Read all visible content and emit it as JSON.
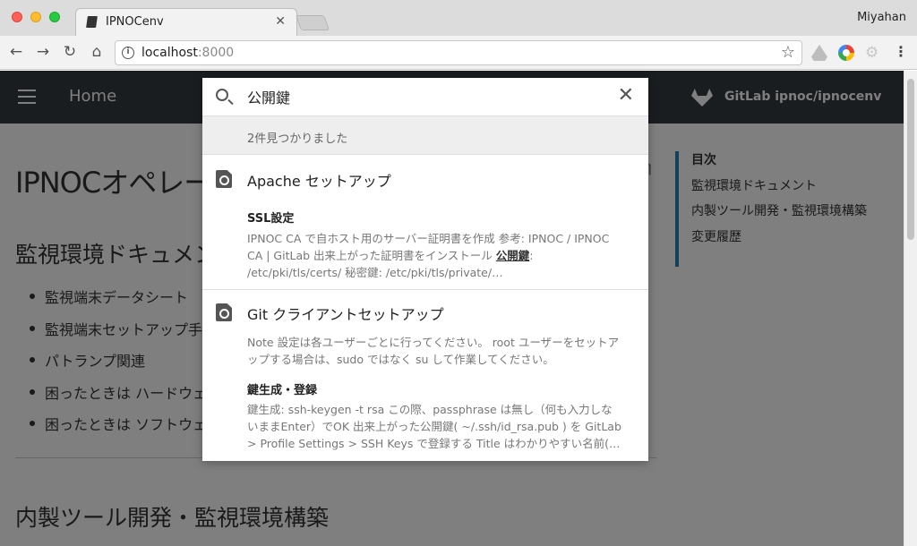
{
  "browser": {
    "tab_title": "IPNOCenv",
    "profile_name": "Miyahan",
    "url_host": "localhost",
    "url_port": ":8000"
  },
  "header": {
    "home_label": "Home",
    "gitlab_label": "GitLab ipnoc/ipnocenv"
  },
  "content": {
    "page_title": "IPNOCオペレーション",
    "section1_title": "監視環境ドキュメント",
    "bullets": [
      "監視端末データシート",
      "監視端末セットアップ手順",
      "パトランプ関連",
      "困ったときは ハードウェア",
      "困ったときは ソフトウェア"
    ],
    "section2_title": "内製ツール開発・監視環境構築"
  },
  "toc": {
    "heading": "目次",
    "items": [
      "監視環境ドキュメント",
      "内製ツール開発・監視環境構築",
      "変更履歴"
    ]
  },
  "search": {
    "query": "公開鍵",
    "result_count": "2件見つかりました",
    "results": [
      {
        "title": "Apache セットアップ",
        "sections": [
          {
            "heading": "SSL設定",
            "snippet_before": "IPNOC CA で自ホスト用のサーバー証明書を作成 参考: IPNOC / IPNOC CA | GitLab 出来上がった証明書をインストール ",
            "snippet_match": "公開鍵",
            "snippet_after": ": /etc/pki/tls/certs/ 秘密鍵: /etc/pki/tls/private/…"
          }
        ]
      },
      {
        "title": "Git クライアントセットアップ",
        "intro": "Note 設定は各ユーザーごとに行ってください。 root ユーザーをセットアップする場合は、sudo ではなく su して作業してください。",
        "sections": [
          {
            "heading": "鍵生成・登録",
            "snippet": "鍵生成: ssh-keygen -t rsa この際、passphrase は無し（何も入力しないままEnter）でOK 出来上がった公開鍵( ~/.ssh/id_rsa.pub ) を GitLab > Profile Settings > SSH Keys で登録する Title はわかりやすい名前(…"
          }
        ]
      }
    ]
  }
}
